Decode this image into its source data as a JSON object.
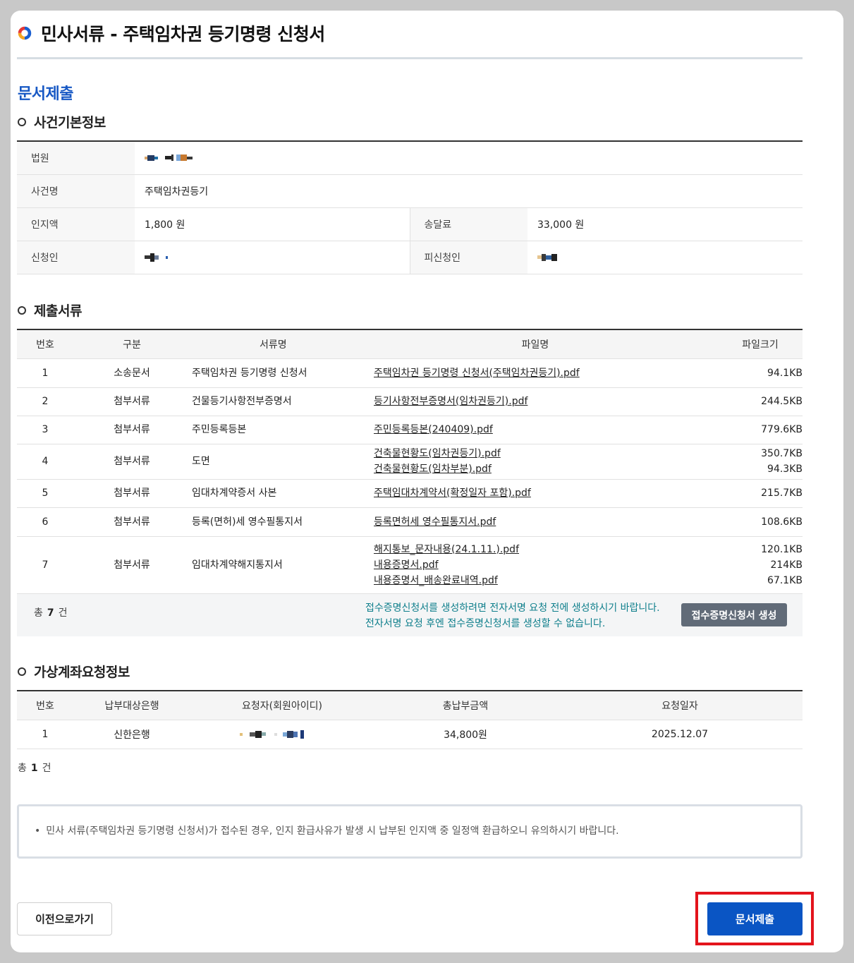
{
  "page_title": "민사서류 - 주택임차권 등기명령 신청서",
  "section_title": "문서제출",
  "case_info": {
    "heading": "사건기본정보",
    "court_label": "법원",
    "case_name_label": "사건명",
    "case_name": "주택임차권등기",
    "stamp_fee_label": "인지액",
    "stamp_fee": "1,800 원",
    "delivery_fee_label": "송달료",
    "delivery_fee": "33,000 원",
    "applicant_label": "신청인",
    "respondent_label": "피신청인"
  },
  "documents": {
    "heading": "제출서류",
    "columns": [
      "번호",
      "구분",
      "서류명",
      "파일명",
      "파일크기"
    ],
    "rows": [
      {
        "no": "1",
        "category": "소송문서",
        "name": "주택임차권 등기명령 신청서",
        "files": [
          "주택임차권 등기명령 신청서(주택임차권등기).pdf"
        ],
        "sizes": [
          "94.1KB"
        ]
      },
      {
        "no": "2",
        "category": "첨부서류",
        "name": "건물등기사항전부증명서",
        "files": [
          "등기사항전부증명서(임차권등기).pdf"
        ],
        "sizes": [
          "244.5KB"
        ]
      },
      {
        "no": "3",
        "category": "첨부서류",
        "name": "주민등록등본",
        "files": [
          "주민등록등본(240409).pdf"
        ],
        "sizes": [
          "779.6KB"
        ]
      },
      {
        "no": "4",
        "category": "첨부서류",
        "name": "도면",
        "files": [
          "건축물현황도(임차권등기).pdf",
          "건축물현황도(임차부분).pdf"
        ],
        "sizes": [
          "350.7KB",
          "94.3KB"
        ]
      },
      {
        "no": "5",
        "category": "첨부서류",
        "name": "임대차계약증서 사본",
        "files": [
          "주택임대차계약서(확정일자 포함).pdf"
        ],
        "sizes": [
          "215.7KB"
        ]
      },
      {
        "no": "6",
        "category": "첨부서류",
        "name": "등록(면허)세 영수필통지서",
        "files": [
          "등록면허세 영수필통지서.pdf"
        ],
        "sizes": [
          "108.6KB"
        ]
      },
      {
        "no": "7",
        "category": "첨부서류",
        "name": "임대차계약해지통지서",
        "files": [
          "해지통보_문자내용(24.1.11.).pdf",
          "내용증명서.pdf",
          "내용증명서_배송완료내역.pdf"
        ],
        "sizes": [
          "120.1KB",
          "214KB",
          "67.1KB"
        ]
      }
    ],
    "total_prefix": "총",
    "total_count": "7",
    "total_suffix": "건",
    "notice_line1": "접수증명신청서를 생성하려면 전자서명 요청 전에 생성하시기 바랍니다.",
    "notice_line2": "전자서명 요청 후엔 접수증명신청서를 생성할 수 없습니다.",
    "generate_button": "접수증명신청서 생성"
  },
  "virtual_account": {
    "heading": "가상계좌요청정보",
    "columns": [
      "번호",
      "납부대상은행",
      "요청자(회원아이디)",
      "총납부금액",
      "요청일자"
    ],
    "rows": [
      {
        "no": "1",
        "bank": "신한은행",
        "amount": "34,800원",
        "date": "2025.12.07"
      }
    ],
    "total_prefix": "총",
    "total_count": "1",
    "total_suffix": "건"
  },
  "notice": "민사 서류(주택임차권 등기명령 신청서)가 접수된 경우, 인지 환급사유가 발생 시 납부된 인지액 중 일정액 환급하오니 유의하시기 바랍니다.",
  "buttons": {
    "previous": "이전으로가기",
    "submit": "문서제출"
  },
  "colors": {
    "accent_blue": "#1758c4",
    "submit_blue": "#0a55c4",
    "highlight_red": "#e3141c",
    "notice_teal": "#0f7f8c",
    "gray_button": "#616b78"
  }
}
